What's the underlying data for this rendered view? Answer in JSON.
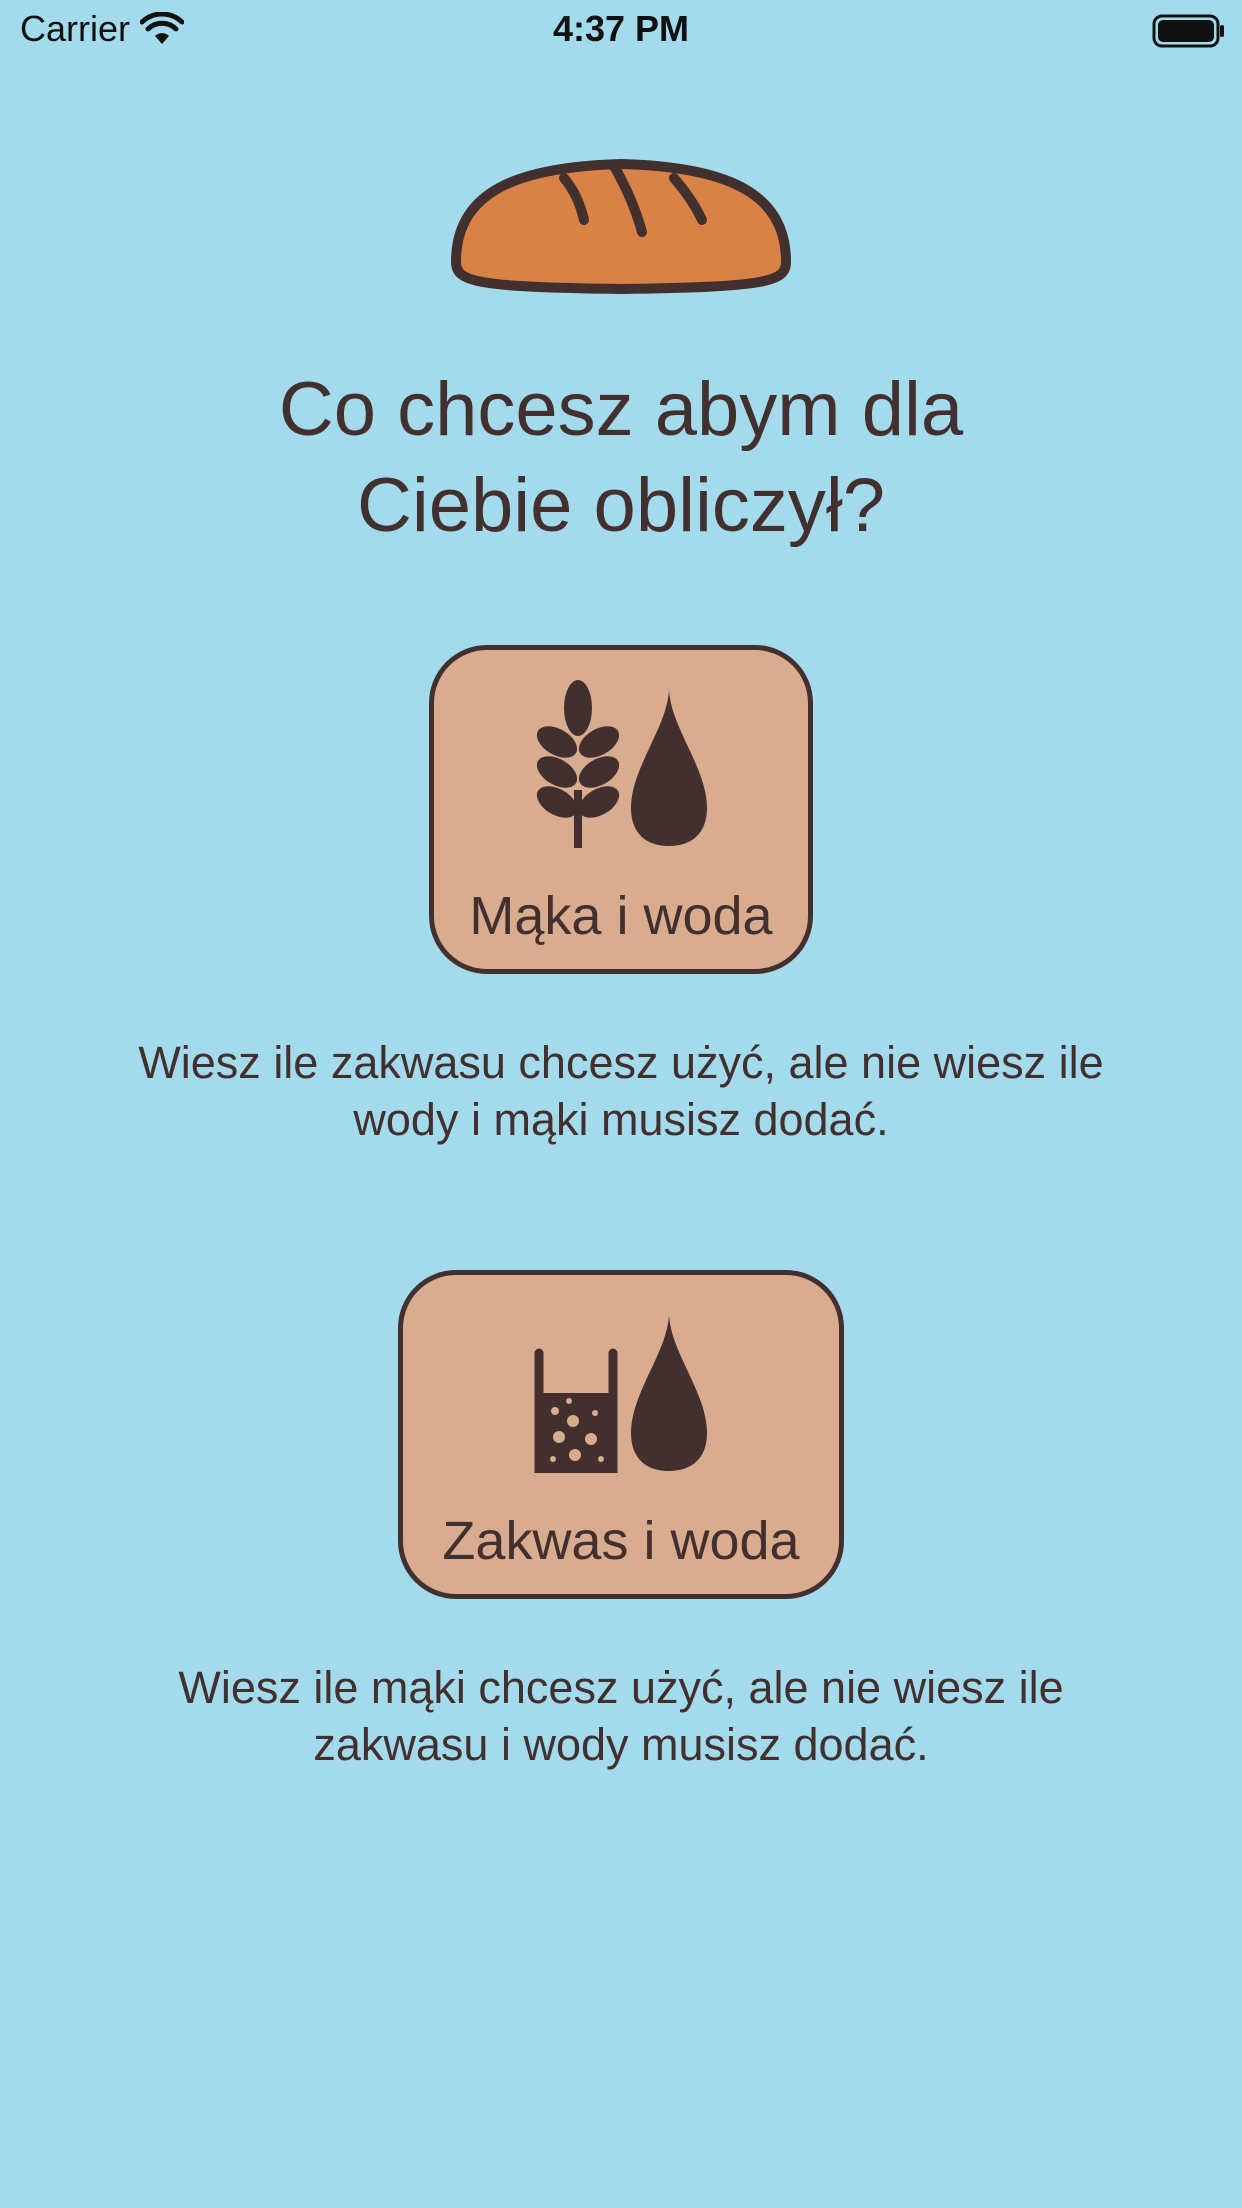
{
  "status_bar": {
    "carrier": "Carrier",
    "time": "4:37 PM"
  },
  "header": {
    "icon": "bread-loaf-icon",
    "title_line1": "Co chcesz abym dla",
    "title_line2": "Ciebie obliczył?"
  },
  "options": [
    {
      "label": "Mąka i woda",
      "icons": [
        "wheat-icon",
        "water-drop-icon"
      ],
      "description_line1": "Wiesz ile zakwasu chcesz użyć, ale nie wiesz ile",
      "description_line2": "wody i mąki musisz dodać."
    },
    {
      "label": "Zakwas i woda",
      "icons": [
        "sourdough-jar-icon",
        "water-drop-icon"
      ],
      "description_line1": "Wiesz ile mąki chcesz użyć, ale nie wiesz ile",
      "description_line2": "zakwasu i wody musisz dodać."
    }
  ],
  "colors": {
    "background": "#a3dbed",
    "button_fill": "#d9ac90",
    "ink": "#42302f",
    "bread": "#d98246"
  }
}
